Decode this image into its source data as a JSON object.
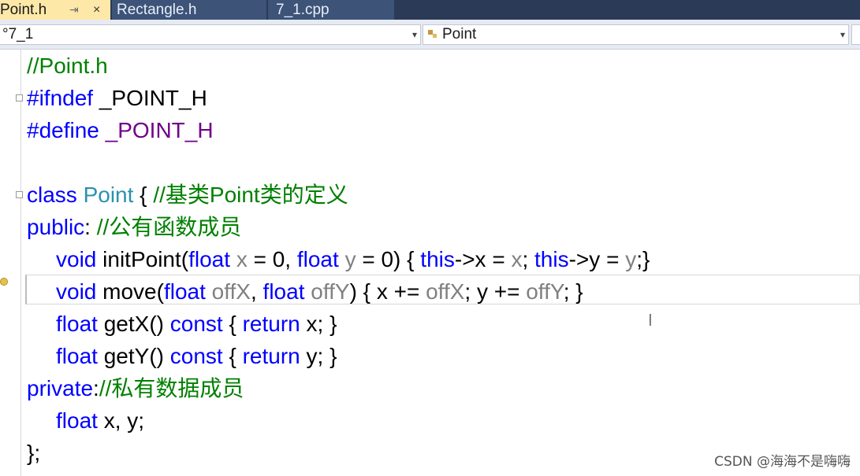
{
  "tabs": [
    {
      "label": "Point.h",
      "pin": "⇥",
      "close": "×"
    },
    {
      "label": "Rectangle.h"
    },
    {
      "label": "7_1.cpp"
    }
  ],
  "nav": {
    "scope_left": "°7_1",
    "scope_right": "Point",
    "arrow": "▾"
  },
  "code": {
    "l1": [
      "//Point.h"
    ],
    "l2": [
      "#ifndef ",
      "_POINT_H"
    ],
    "l3": [
      "#define ",
      "_POINT_H"
    ],
    "l5": [
      "class ",
      "Point",
      " { ",
      "//基类Point类的定义"
    ],
    "l6": [
      "public",
      ": ",
      "//公有函数成员"
    ],
    "l7": [
      "void",
      " initPoint(",
      "float",
      " ",
      "x",
      " = 0, ",
      "float",
      " ",
      "y",
      " = 0) { ",
      "this",
      "->x = ",
      "x",
      "; ",
      "this",
      "->y = ",
      "y",
      ";}"
    ],
    "l8": [
      "void",
      " move(",
      "float",
      " ",
      "offX",
      ", ",
      "float",
      " ",
      "offY",
      ") { x += ",
      "offX",
      "; y += ",
      "offY",
      "; }"
    ],
    "l9": [
      "float",
      " getX() ",
      "const",
      " { ",
      "return",
      " x; }"
    ],
    "l10": [
      "float",
      " getY() ",
      "const",
      " { ",
      "return",
      " y; }"
    ],
    "l11": [
      "private",
      ":",
      "//私有数据成员"
    ],
    "l12": [
      "float",
      " x, y;"
    ],
    "l13": [
      "};"
    ]
  },
  "watermark": "CSDN @海海不是嗨嗨",
  "colors": {
    "comment": "#008000",
    "keyword": "#0000ff",
    "macro": "#6f008a",
    "type": "#2b91af",
    "param": "#808080",
    "tab_active": "#fde8a8",
    "tab_bar": "#2b3a56"
  }
}
